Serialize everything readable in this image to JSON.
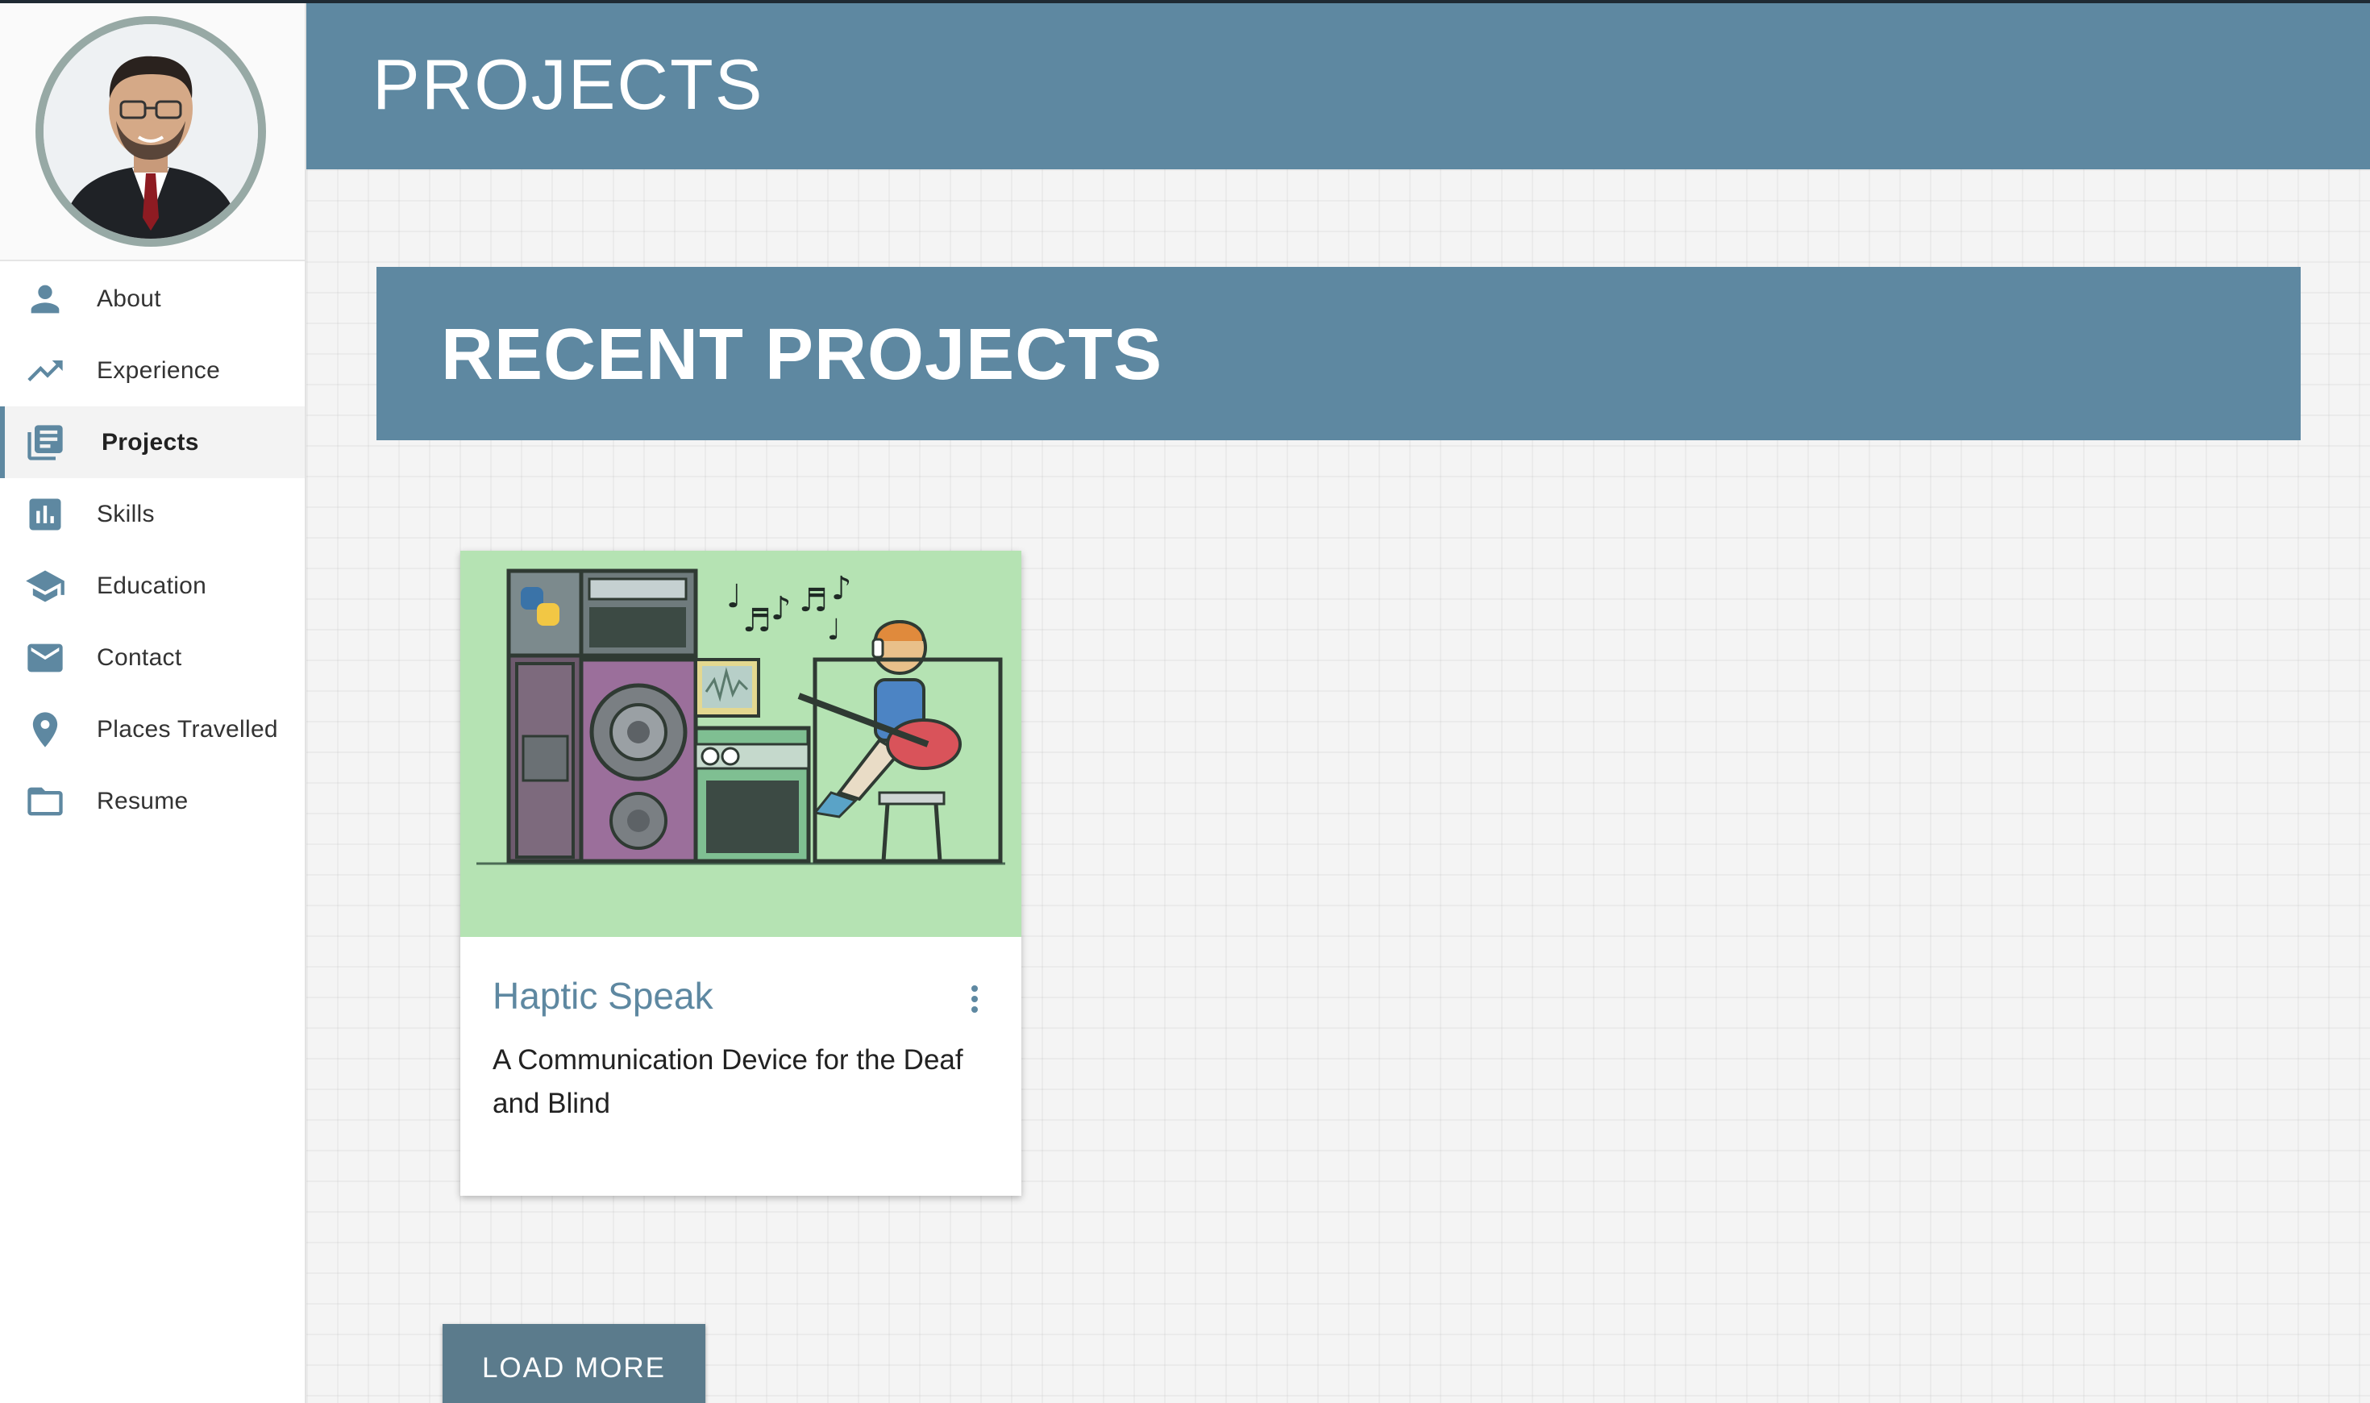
{
  "colors": {
    "accent": "#5e88a1",
    "button": "#5b7b8c",
    "card_media_bg": "#b5e3b3",
    "page_bg": "#f4f4f4"
  },
  "sidebar": {
    "profile": {
      "avatar_icon": "profile-photo"
    },
    "items": [
      {
        "label": "About",
        "icon": "person-icon",
        "active": false
      },
      {
        "label": "Experience",
        "icon": "trending-up-icon",
        "active": false
      },
      {
        "label": "Projects",
        "icon": "library-books-icon",
        "active": true
      },
      {
        "label": "Skills",
        "icon": "bar-chart-icon",
        "active": false
      },
      {
        "label": "Education",
        "icon": "graduation-cap-icon",
        "active": false
      },
      {
        "label": "Contact",
        "icon": "mail-icon",
        "active": false
      },
      {
        "label": "Places Travelled",
        "icon": "location-pin-icon",
        "active": false
      },
      {
        "label": "Resume",
        "icon": "folder-icon",
        "active": false
      }
    ]
  },
  "header": {
    "title": "PROJECTS"
  },
  "main": {
    "section_title": "RECENT PROJECTS",
    "projects": [
      {
        "title": "Haptic Speak",
        "description": "A Communication Device for the Deaf and Blind",
        "image_icon": "music-studio-illustration",
        "menu_icon": "more-vert-icon"
      }
    ],
    "load_more_label": "LOAD MORE"
  }
}
